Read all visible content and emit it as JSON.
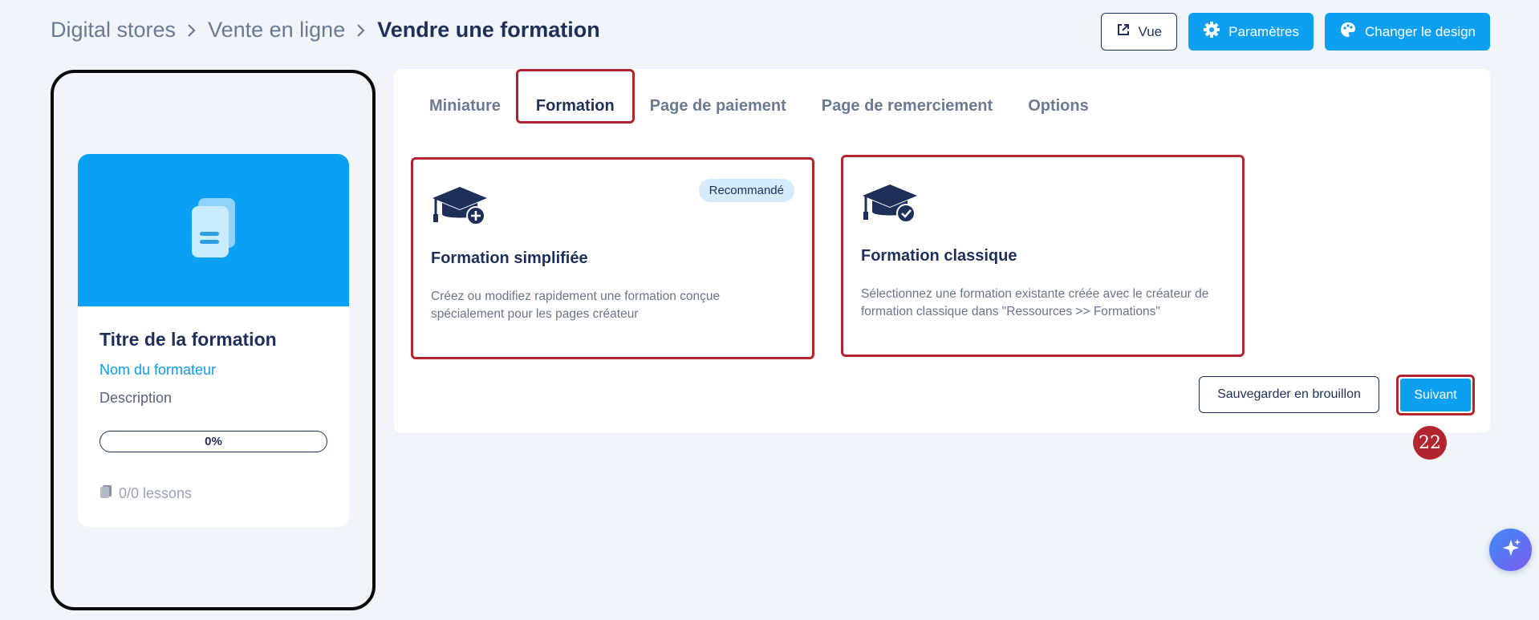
{
  "breadcrumb": {
    "items": [
      "Digital stores",
      "Vente en ligne"
    ],
    "current": "Vendre une formation"
  },
  "header": {
    "view_label": "Vue",
    "settings_label": "Paramètres",
    "design_label": "Changer le design"
  },
  "preview": {
    "title": "Titre de la formation",
    "author": "Nom du formateur",
    "description": "Description",
    "progress": "0%",
    "lessons": "0/0 lessons"
  },
  "tabs": {
    "items": [
      "Miniature",
      "Formation",
      "Page de paiement",
      "Page de remerciement",
      "Options"
    ],
    "active": "Formation"
  },
  "options": {
    "simplified": {
      "badge": "Recommandé",
      "title": "Formation simplifiée",
      "description": "Créez ou modifiez rapidement une formation conçue spécialement pour les pages créateur"
    },
    "classic": {
      "title": "Formation classique",
      "description": "Sélectionnez une formation existante créée avec le créateur de formation classique dans \"Ressources >> Formations\""
    }
  },
  "actions": {
    "draft_label": "Sauvegarder en brouillon",
    "next_label": "Suivant"
  },
  "step_badge": "22",
  "colors": {
    "primary": "#0ea0f0",
    "navy": "#1e2f5a",
    "highlight": "#b3252e",
    "background": "#f1f4f9"
  }
}
